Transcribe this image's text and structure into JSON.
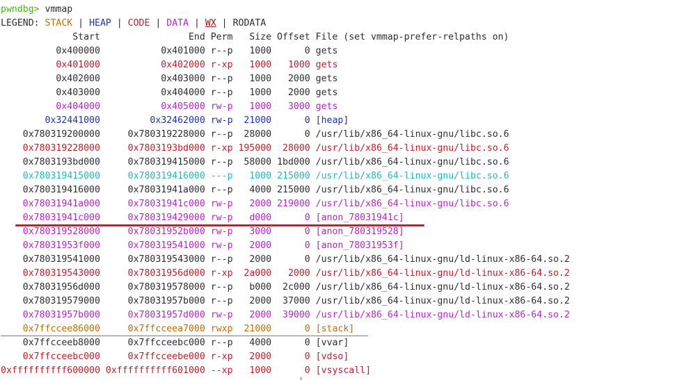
{
  "prompt": {
    "name": "pwndbg>",
    "command": "vmmap"
  },
  "legend": {
    "label": "LEGEND:",
    "separator": "|",
    "items": [
      {
        "text": "STACK",
        "class": "c-stack"
      },
      {
        "text": "HEAP",
        "class": "c-heap"
      },
      {
        "text": "CODE",
        "class": "c-code"
      },
      {
        "text": "DATA",
        "class": "c-data"
      },
      {
        "text": "WX",
        "class": "c-wx"
      },
      {
        "text": "RODATA",
        "class": "c-rodata"
      }
    ]
  },
  "columns": {
    "start": "Start",
    "end": "End",
    "perm": "Perm",
    "size": "Size",
    "offset": "Offset",
    "file": "File (set vmmap-prefer-relpaths on)"
  },
  "colors": {
    "stack": "#c56c00",
    "heap": "#1c32b0",
    "code": "#c01c28",
    "data": "#b723c9",
    "cyan": "#1eb8b8",
    "plain": "#2e2e2e",
    "prompt": "#4ab118",
    "highlight_line": "#e0141e"
  },
  "rows": [
    {
      "start": "0x400000",
      "end": "0x401000",
      "perm": "r--p",
      "size": "1000",
      "offset": "0",
      "file": "gets",
      "cls": "c-plain"
    },
    {
      "start": "0x401000",
      "end": "0x402000",
      "perm": "r-xp",
      "size": "1000",
      "offset": "1000",
      "file": "gets",
      "cls": "c-code"
    },
    {
      "start": "0x402000",
      "end": "0x403000",
      "perm": "r--p",
      "size": "1000",
      "offset": "2000",
      "file": "gets",
      "cls": "c-plain"
    },
    {
      "start": "0x403000",
      "end": "0x404000",
      "perm": "r--p",
      "size": "1000",
      "offset": "2000",
      "file": "gets",
      "cls": "c-plain"
    },
    {
      "start": "0x404000",
      "end": "0x405000",
      "perm": "rw-p",
      "size": "1000",
      "offset": "3000",
      "file": "gets",
      "cls": "c-data"
    },
    {
      "start": "0x32441000",
      "end": "0x32462000",
      "perm": "rw-p",
      "size": "21000",
      "offset": "0",
      "file": "[heap]",
      "cls": "c-heap"
    },
    {
      "start": "0x780319200000",
      "end": "0x780319228000",
      "perm": "r--p",
      "size": "28000",
      "offset": "0",
      "file": "/usr/lib/x86_64-linux-gnu/libc.so.6",
      "cls": "c-plain"
    },
    {
      "start": "0x780319228000",
      "end": "0x7803193bd000",
      "perm": "r-xp",
      "size": "195000",
      "offset": "28000",
      "file": "/usr/lib/x86_64-linux-gnu/libc.so.6",
      "cls": "c-code"
    },
    {
      "start": "0x7803193bd000",
      "end": "0x780319415000",
      "perm": "r--p",
      "size": "58000",
      "offset": "1bd000",
      "file": "/usr/lib/x86_64-linux-gnu/libc.so.6",
      "cls": "c-plain"
    },
    {
      "start": "0x780319415000",
      "end": "0x780319416000",
      "perm": "---p",
      "size": "1000",
      "offset": "215000",
      "file": "/usr/lib/x86_64-linux-gnu/libc.so.6",
      "cls": "c-cyan"
    },
    {
      "start": "0x780319416000",
      "end": "0x78031941a000",
      "perm": "r--p",
      "size": "4000",
      "offset": "215000",
      "file": "/usr/lib/x86_64-linux-gnu/libc.so.6",
      "cls": "c-plain"
    },
    {
      "start": "0x78031941a000",
      "end": "0x78031941c000",
      "perm": "rw-p",
      "size": "2000",
      "offset": "219000",
      "file": "/usr/lib/x86_64-linux-gnu/libc.so.6",
      "cls": "c-data"
    },
    {
      "start": "0x78031941c000",
      "end": "0x780319429000",
      "perm": "rw-p",
      "size": "d000",
      "offset": "0",
      "file": "[anon_78031941c]",
      "cls": "c-data"
    },
    {
      "start": "0x780319528000",
      "end": "0x78031952b000",
      "perm": "rw-p",
      "size": "3000",
      "offset": "0",
      "file": "[anon_780319528]",
      "cls": "c-data"
    },
    {
      "start": "0x78031953f000",
      "end": "0x780319541000",
      "perm": "rw-p",
      "size": "2000",
      "offset": "0",
      "file": "[anon_78031953f]",
      "cls": "c-data"
    },
    {
      "start": "0x780319541000",
      "end": "0x780319543000",
      "perm": "r--p",
      "size": "2000",
      "offset": "0",
      "file": "/usr/lib/x86_64-linux-gnu/ld-linux-x86-64.so.2",
      "cls": "c-plain"
    },
    {
      "start": "0x780319543000",
      "end": "0x78031956d000",
      "perm": "r-xp",
      "size": "2a000",
      "offset": "2000",
      "file": "/usr/lib/x86_64-linux-gnu/ld-linux-x86-64.so.2",
      "cls": "c-code"
    },
    {
      "start": "0x78031956d000",
      "end": "0x780319578000",
      "perm": "r--p",
      "size": "b000",
      "offset": "2c000",
      "file": "/usr/lib/x86_64-linux-gnu/ld-linux-x86-64.so.2",
      "cls": "c-plain"
    },
    {
      "start": "0x780319579000",
      "end": "0x78031957b000",
      "perm": "r--p",
      "size": "2000",
      "offset": "37000",
      "file": "/usr/lib/x86_64-linux-gnu/ld-linux-x86-64.so.2",
      "cls": "c-plain"
    },
    {
      "start": "0x78031957b000",
      "end": "0x78031957d000",
      "perm": "rw-p",
      "size": "2000",
      "offset": "39000",
      "file": "/usr/lib/x86_64-linux-gnu/ld-linux-x86-64.so.2",
      "cls": "c-data"
    },
    {
      "start": "0x7ffccee86000",
      "end": "0x7ffcceea7000",
      "perm": "rwxp",
      "size": "21000",
      "offset": "0",
      "file": "[stack]",
      "cls": "c-stack",
      "underline": true
    },
    {
      "start": "0x7ffcceeb8000",
      "end": "0x7ffcceebc000",
      "perm": "r--p",
      "size": "4000",
      "offset": "0",
      "file": "[vvar]",
      "cls": "c-plain"
    },
    {
      "start": "0x7ffcceebc000",
      "end": "0x7ffcceebe000",
      "perm": "r-xp",
      "size": "2000",
      "offset": "0",
      "file": "[vdso]",
      "cls": "c-code"
    },
    {
      "start": "0xffffffffff600000",
      "end": "0xffffffffff601000",
      "perm": "--xp",
      "size": "1000",
      "offset": "0",
      "file": "[vsyscall]",
      "cls": "c-code"
    }
  ]
}
